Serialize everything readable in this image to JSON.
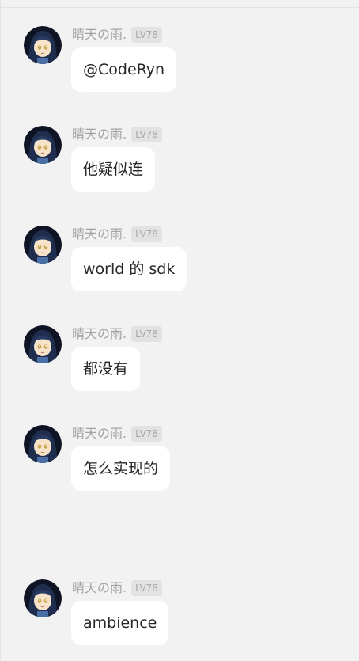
{
  "messages": [
    {
      "nickname": "晴天の雨.",
      "level": "LV78",
      "text": "@CodeRyn"
    },
    {
      "nickname": "晴天の雨.",
      "level": "LV78",
      "text": "他疑似连"
    },
    {
      "nickname": "晴天の雨.",
      "level": "LV78",
      "text": "world 的 sdk"
    },
    {
      "nickname": "晴天の雨.",
      "level": "LV78",
      "text": "都没有"
    },
    {
      "nickname": "晴天の雨.",
      "level": "LV78",
      "text": "怎么实现的"
    },
    {
      "nickname": "晴天の雨.",
      "level": "LV78",
      "text": "ambience"
    }
  ],
  "colors": {
    "background": "#f2f2f2",
    "bubble": "#ffffff",
    "nickname": "#a3a3a3",
    "level_badge": "#e2e2e2",
    "message_text": "#262626"
  },
  "avatar_icon": "anime-girl-avatar-icon"
}
